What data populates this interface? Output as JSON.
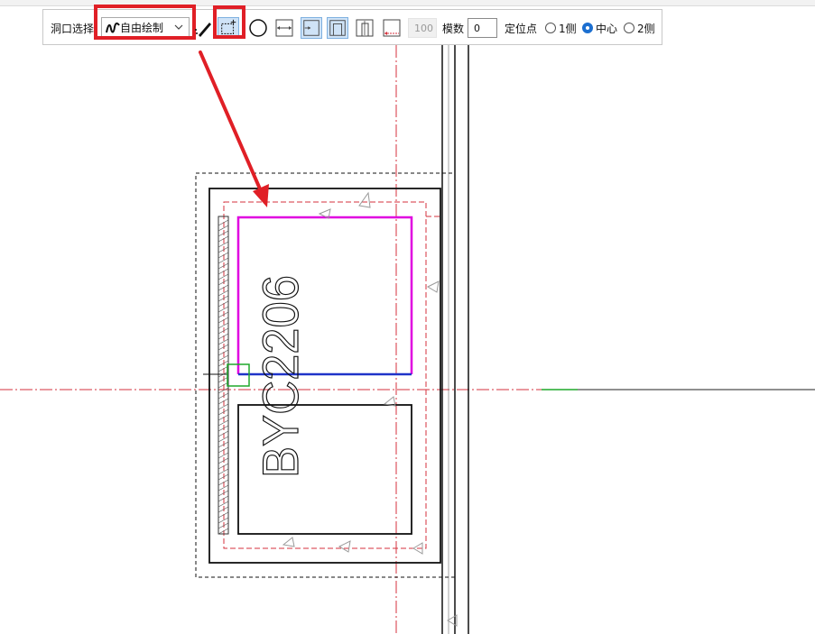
{
  "toolbar": {
    "hole_select_label": "洞口选择",
    "draw_mode_value": "自由绘制",
    "disabled_value": "100",
    "modulus_label": "模数",
    "modulus_value": "0",
    "anchor_label": "定位点",
    "anchor_options": [
      {
        "label": "1侧",
        "checked": false
      },
      {
        "label": "中心",
        "checked": true
      },
      {
        "label": "2侧",
        "checked": false
      }
    ],
    "icons": [
      "freehand-draw-icon",
      "pencil-edit-icon",
      "rectangle-draw-icon",
      "circle-icon",
      "width-span-icon",
      "offset-left-icon",
      "door-shape-icon",
      "center-frame-icon",
      "bottom-offset-icon"
    ]
  },
  "drawing": {
    "element_label": "BYC2206"
  },
  "colors": {
    "highlight": "#e01f26",
    "magenta": "#e000e0",
    "blue": "#1f33c9",
    "axis": "#d4323c",
    "green": "#1fa82a"
  }
}
